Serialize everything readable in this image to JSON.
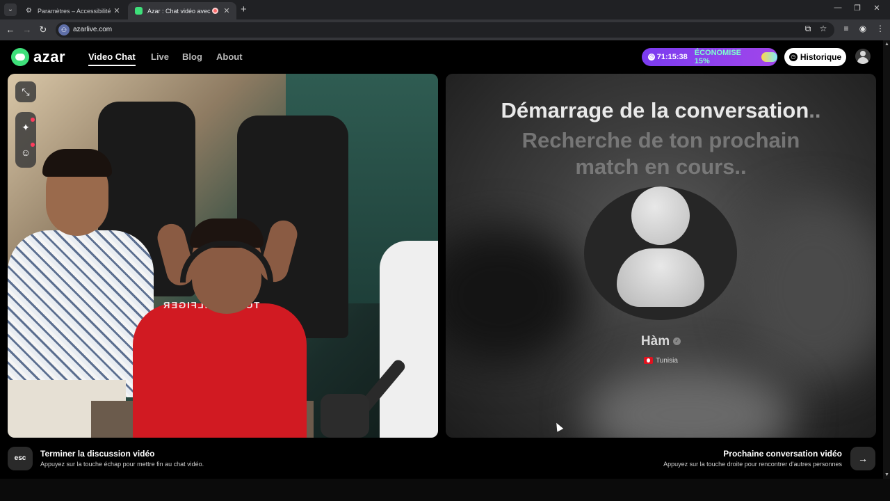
{
  "browser": {
    "tabs": [
      {
        "title": "Paramètres – Accessibilité",
        "icon": "gear-icon"
      },
      {
        "title": "Azar : Chat vidéo avec de n",
        "icon": "azar-favicon",
        "recording": true
      }
    ],
    "url": "azarlive.com"
  },
  "site": {
    "logo_text": "azar",
    "nav": [
      {
        "label": "Video Chat",
        "active": true
      },
      {
        "label": "Live"
      },
      {
        "label": "Blog"
      },
      {
        "label": "About"
      }
    ],
    "promo": {
      "timer": "71:15:38",
      "text": "ÉCONOMISE 15%"
    },
    "history_label": "Historique",
    "accent_color": "#8b3ff0"
  },
  "right_panel": {
    "title": "Démarrage de la conversation",
    "title_dots": "..",
    "subtitle": "Recherche de ton prochain match en cours..",
    "peer": {
      "name": "Hàm",
      "country": "Tunisia"
    }
  },
  "footer": {
    "left": {
      "key": "esc",
      "title": "Terminer la discussion vidéo",
      "subtitle": "Appuyez sur la touche échap pour mettre fin au chat vidéo."
    },
    "right": {
      "key": "→",
      "title": "Prochaine conversation vidéo",
      "subtitle": "Appuyez sur la touche droite pour rencontrer d'autres personnes"
    }
  },
  "webcam_overlay": {
    "shirt_text": "TOMMY HILFIGER"
  }
}
